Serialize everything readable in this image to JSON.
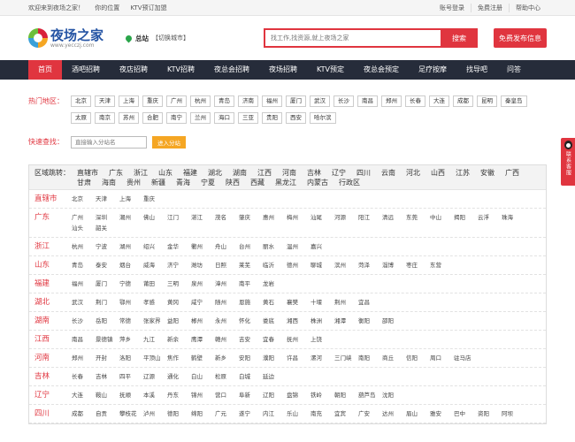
{
  "topbar": {
    "welcome": "欢迎来到夜场之家！",
    "location_label": "你的位置",
    "location_value": "KTV预订加盟",
    "links": [
      "账号登录",
      "免费注册",
      "帮助中心"
    ]
  },
  "header": {
    "logo_title": "夜场之家",
    "logo_sub": "www.yecczj.com",
    "city": "总站",
    "city_switch": "【切换城市】",
    "search_placeholder": "找工作,找资源,就上夜场之家",
    "search_button": "搜索",
    "post_button": "免费发布信息"
  },
  "nav": [
    "首页",
    "酒吧招聘",
    "夜店招聘",
    "KTV招聘",
    "夜总会招聘",
    "夜场招聘",
    "KTV预定",
    "夜总会预定",
    "足疗按摩",
    "找导吧",
    "问答"
  ],
  "hot": {
    "label": "热门地区：",
    "cities": [
      "北京",
      "天津",
      "上海",
      "重庆",
      "广州",
      "杭州",
      "青岛",
      "济南",
      "福州",
      "厦门",
      "武汉",
      "长沙",
      "南昌",
      "郑州",
      "长春",
      "大连",
      "成都",
      "昆明",
      "秦皇岛",
      "太原",
      "南京",
      "苏州",
      "合肥",
      "南宁",
      "兰州",
      "海口",
      "三亚",
      "贵阳",
      "西安",
      "哈尔滨"
    ]
  },
  "quick": {
    "label": "快速查找：",
    "placeholder": "直接输入分站名",
    "button": "进入分站"
  },
  "region": {
    "label": "区域跳转：",
    "provinces": [
      "直辖市",
      "广东",
      "浙江",
      "山东",
      "福建",
      "湖北",
      "湖南",
      "江西",
      "河南",
      "吉林",
      "辽宁",
      "四川",
      "云南",
      "河北",
      "山西",
      "江苏",
      "安徽",
      "广西",
      "甘肃",
      "海南",
      "贵州",
      "新疆",
      "青海",
      "宁夏",
      "陕西",
      "西藏",
      "黑龙江",
      "内蒙古",
      "行政区"
    ]
  },
  "provinces": [
    {
      "name": "直辖市",
      "cities": [
        "北京",
        "天津",
        "上海",
        "重庆"
      ]
    },
    {
      "name": "广东",
      "cities": [
        "广州",
        "深圳",
        "潮州",
        "佛山",
        "江门",
        "湛江",
        "茂名",
        "肇庆",
        "惠州",
        "梅州",
        "汕尾",
        "河源",
        "阳江",
        "清远",
        "东莞",
        "中山",
        "揭阳",
        "云浮",
        "珠海",
        "汕头",
        "韶关"
      ]
    },
    {
      "name": "浙江",
      "cities": [
        "杭州",
        "宁波",
        "湖州",
        "绍兴",
        "金华",
        "衢州",
        "舟山",
        "台州",
        "丽水",
        "温州",
        "嘉兴"
      ]
    },
    {
      "name": "山东",
      "cities": [
        "青岛",
        "泰安",
        "烟台",
        "威海",
        "济宁",
        "潍坊",
        "日照",
        "莱芜",
        "临沂",
        "德州",
        "聊城",
        "滨州",
        "菏泽",
        "淄博",
        "枣庄",
        "东营"
      ]
    },
    {
      "name": "福建",
      "cities": [
        "福州",
        "厦门",
        "宁德",
        "莆田",
        "三明",
        "泉州",
        "漳州",
        "南平",
        "龙岩"
      ]
    },
    {
      "name": "湖北",
      "cities": [
        "武汉",
        "荆门",
        "鄂州",
        "孝感",
        "黄冈",
        "咸宁",
        "随州",
        "恩施",
        "黄石",
        "襄樊",
        "十堰",
        "荆州",
        "宜昌"
      ]
    },
    {
      "name": "湖南",
      "cities": [
        "长沙",
        "岳阳",
        "常德",
        "张家界",
        "益阳",
        "郴州",
        "永州",
        "怀化",
        "娄底",
        "湘西",
        "株洲",
        "湘潭",
        "衡阳",
        "邵阳"
      ]
    },
    {
      "name": "江西",
      "cities": [
        "南昌",
        "景德镇",
        "萍乡",
        "九江",
        "新余",
        "鹰潭",
        "赣州",
        "吉安",
        "宜春",
        "抚州",
        "上饶"
      ]
    },
    {
      "name": "河南",
      "cities": [
        "郑州",
        "开封",
        "洛阳",
        "平顶山",
        "焦作",
        "鹤壁",
        "新乡",
        "安阳",
        "濮阳",
        "许昌",
        "漯河",
        "三门峡",
        "南阳",
        "商丘",
        "信阳",
        "周口",
        "驻马店"
      ]
    },
    {
      "name": "吉林",
      "cities": [
        "长春",
        "吉林",
        "四平",
        "辽源",
        "通化",
        "白山",
        "松原",
        "白城",
        "延边"
      ]
    },
    {
      "name": "辽宁",
      "cities": [
        "大连",
        "鞍山",
        "抚顺",
        "本溪",
        "丹东",
        "锦州",
        "营口",
        "阜新",
        "辽阳",
        "盘锦",
        "铁岭",
        "朝阳",
        "葫芦岛",
        "沈阳"
      ]
    },
    {
      "name": "四川",
      "cities": [
        "成都",
        "自贡",
        "攀枝花",
        "泸州",
        "德阳",
        "绵阳",
        "广元",
        "遂宁",
        "内江",
        "乐山",
        "南充",
        "宜宾",
        "广安",
        "达州",
        "眉山",
        "雅安",
        "巴中",
        "资阳",
        "阿坝"
      ]
    }
  ],
  "side_float": {
    "text": "联系客服"
  }
}
